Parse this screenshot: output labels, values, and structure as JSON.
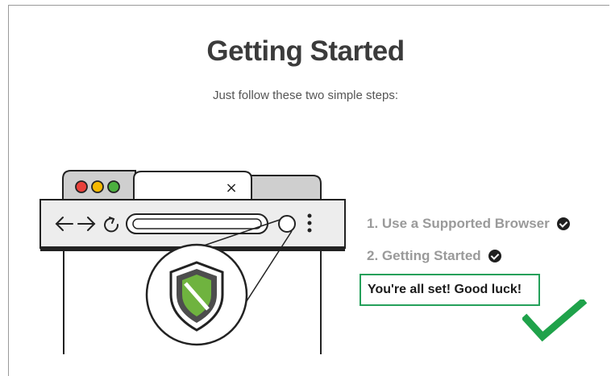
{
  "page": {
    "title": "Getting Started",
    "subtitle": "Just follow these two simple steps:"
  },
  "browser_illustration": {
    "close_glyph": "×",
    "icons": [
      "traffic-light-icons",
      "back-arrow-icon",
      "forward-arrow-icon",
      "reload-icon",
      "kebab-menu-icon",
      "shield-icon"
    ]
  },
  "steps": [
    {
      "label": "1. Use a Supported Browser",
      "status": "complete"
    },
    {
      "label": "2. Getting Started",
      "status": "complete"
    }
  ],
  "completion": {
    "message": "You're all set! Good luck!"
  },
  "colors": {
    "title": "#3b3b3b",
    "step_done_text": "#9a9a9a",
    "success_green": "#24a05a",
    "check_green": "#1fa24a",
    "traffic_red": "#e8413b",
    "traffic_yellow": "#f5b800",
    "traffic_green": "#4caf3f",
    "shield_green": "#6fb33f"
  }
}
